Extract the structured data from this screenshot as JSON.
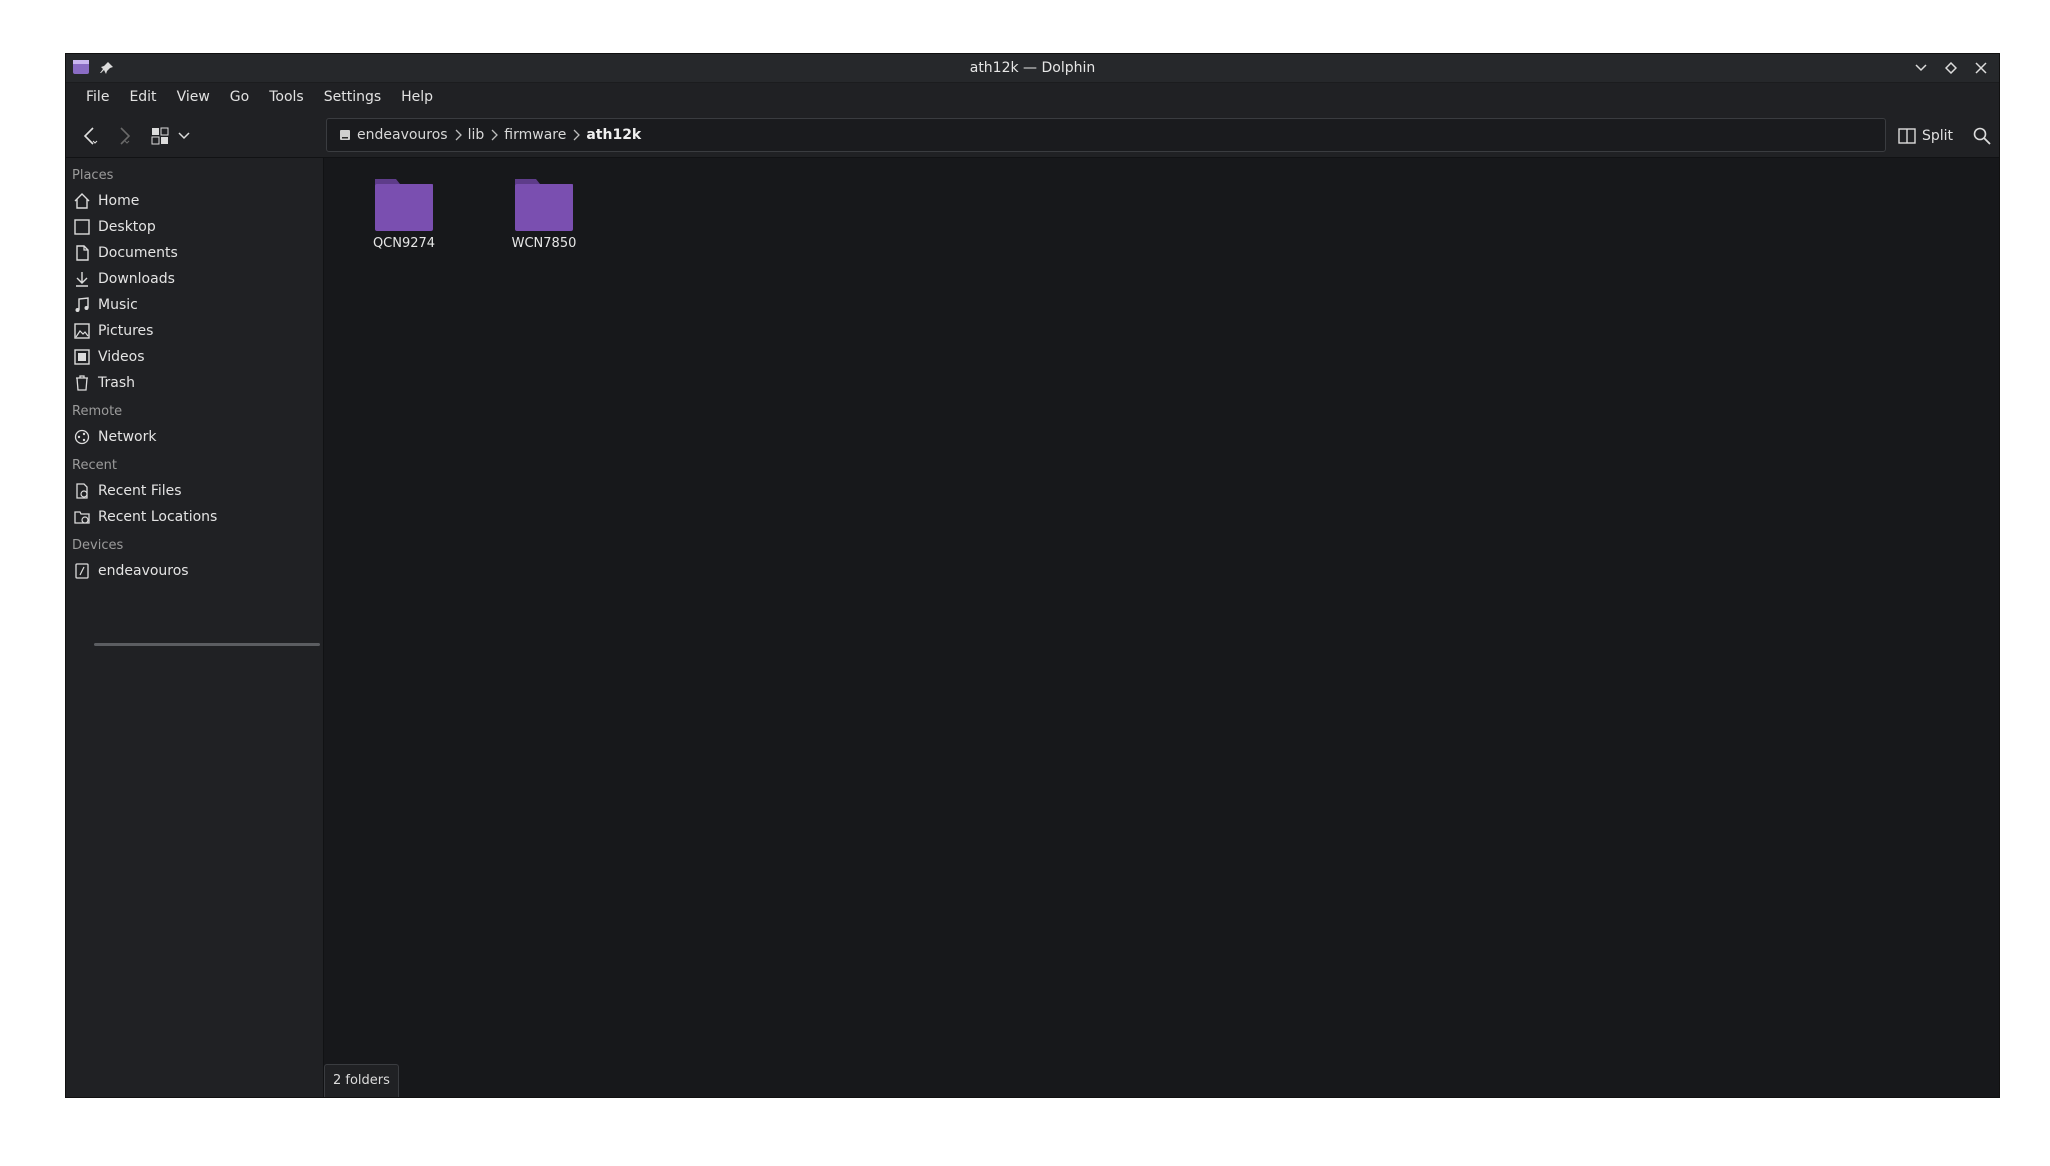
{
  "window": {
    "title": "ath12k — Dolphin"
  },
  "menu": [
    "File",
    "Edit",
    "View",
    "Go",
    "Tools",
    "Settings",
    "Help"
  ],
  "breadcrumb": {
    "items": [
      "endeavouros",
      "lib",
      "firmware",
      "ath12k"
    ]
  },
  "toolbar": {
    "split_label": "Split"
  },
  "sidebar": {
    "places_header": "Places",
    "places": [
      "Home",
      "Desktop",
      "Documents",
      "Downloads",
      "Music",
      "Pictures",
      "Videos",
      "Trash"
    ],
    "remote_header": "Remote",
    "remote": [
      "Network"
    ],
    "recent_header": "Recent",
    "recent": [
      "Recent Files",
      "Recent Locations"
    ],
    "devices_header": "Devices",
    "devices": [
      "endeavouros"
    ]
  },
  "files": [
    "QCN9274",
    "WCN7850"
  ],
  "status": {
    "text": "2 folders"
  },
  "colors": {
    "folder": "#7a4fb0",
    "folder_tab": "#5e3c8a",
    "window_bg": "#202124",
    "view_bg": "#17181b"
  }
}
